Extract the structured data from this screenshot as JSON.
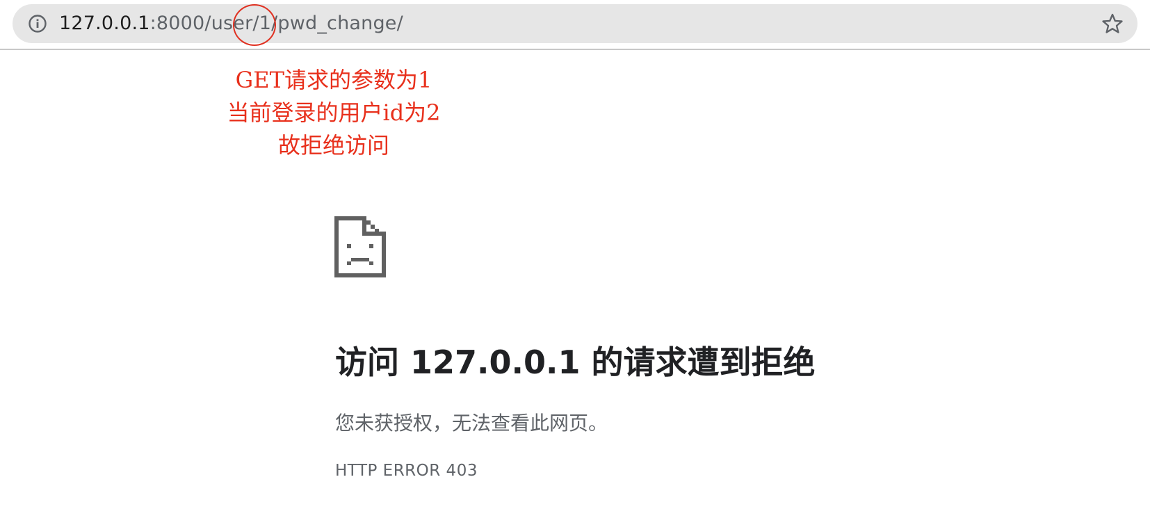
{
  "browser": {
    "url_host": "127.0.0.1",
    "url_rest": ":8000/user/1/pwd_change/",
    "info_icon": "info-icon",
    "star_icon": "bookmark-star-icon"
  },
  "annotation": {
    "color": "#e8301c",
    "lines": [
      "GET请求的参数为1",
      "当前登录的用户id为2",
      "故拒绝访问"
    ]
  },
  "error": {
    "icon": "sad-page-icon",
    "title": "访问 127.0.0.1 的请求遭到拒绝",
    "description": "您未获授权，无法查看此网页。",
    "code": "HTTP ERROR 403"
  }
}
